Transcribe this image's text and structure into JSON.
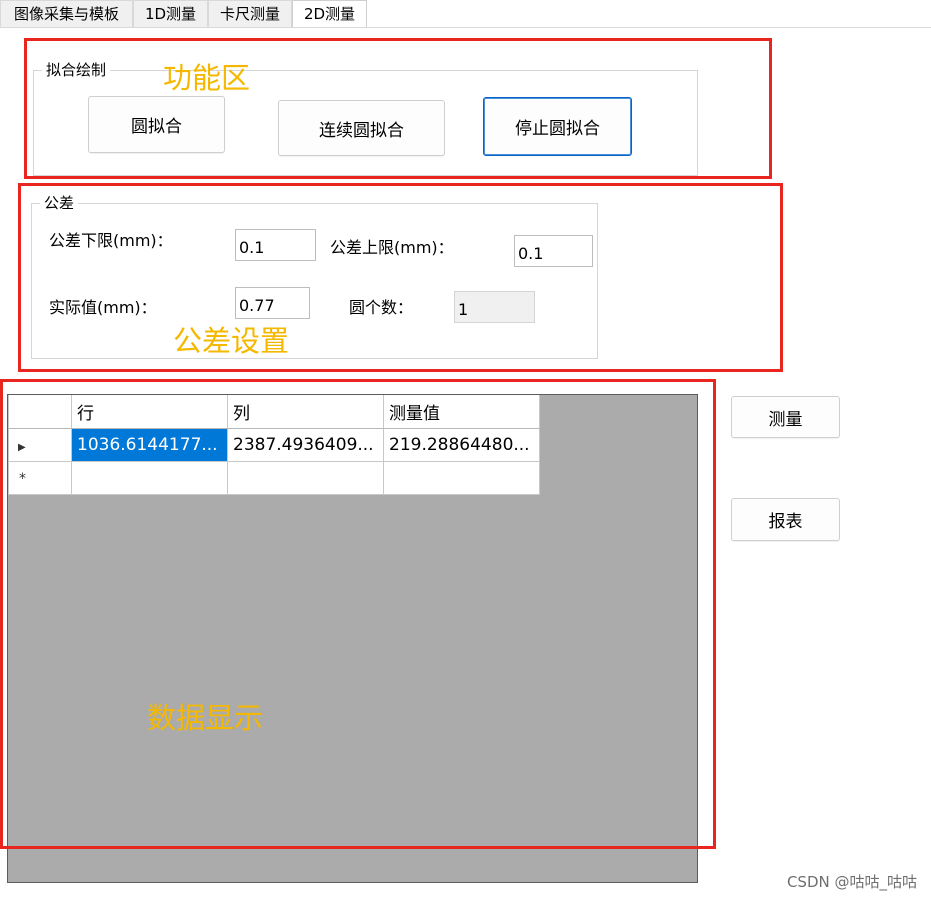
{
  "tabs": [
    {
      "label": "图像采集与模板",
      "active": false
    },
    {
      "label": "1D测量",
      "active": false
    },
    {
      "label": "卡尺测量",
      "active": false
    },
    {
      "label": "2D测量",
      "active": true
    }
  ],
  "fit_group": {
    "title": "拟合绘制",
    "buttons": {
      "circle_fit": "圆拟合",
      "continuous_fit": "连续圆拟合",
      "stop_fit": "停止圆拟合"
    }
  },
  "tolerance_group": {
    "title": "公差",
    "lower_label": "公差下限(mm)：",
    "lower_value": "0.1",
    "upper_label": "公差上限(mm)：",
    "upper_value": "0.1",
    "actual_label": "实际值(mm)：",
    "actual_value": "0.77",
    "count_label": "圆个数：",
    "count_value": "1"
  },
  "grid": {
    "columns": [
      "行",
      "列",
      "测量值"
    ],
    "rows": [
      [
        "1036.6144177...",
        "2387.4936409...",
        "219.28864480..."
      ]
    ]
  },
  "side_buttons": {
    "measure": "测量",
    "report": "报表"
  },
  "annotations": {
    "function_area": "功能区",
    "tolerance_settings": "公差设置",
    "data_display": "数据显示"
  },
  "colors": {
    "annotation_border": "#e8251f",
    "annotation_text": "#f5b800",
    "selection": "#0078d7",
    "grid_background": "#ababab"
  },
  "watermark": "CSDN @咕咕_咕咕"
}
